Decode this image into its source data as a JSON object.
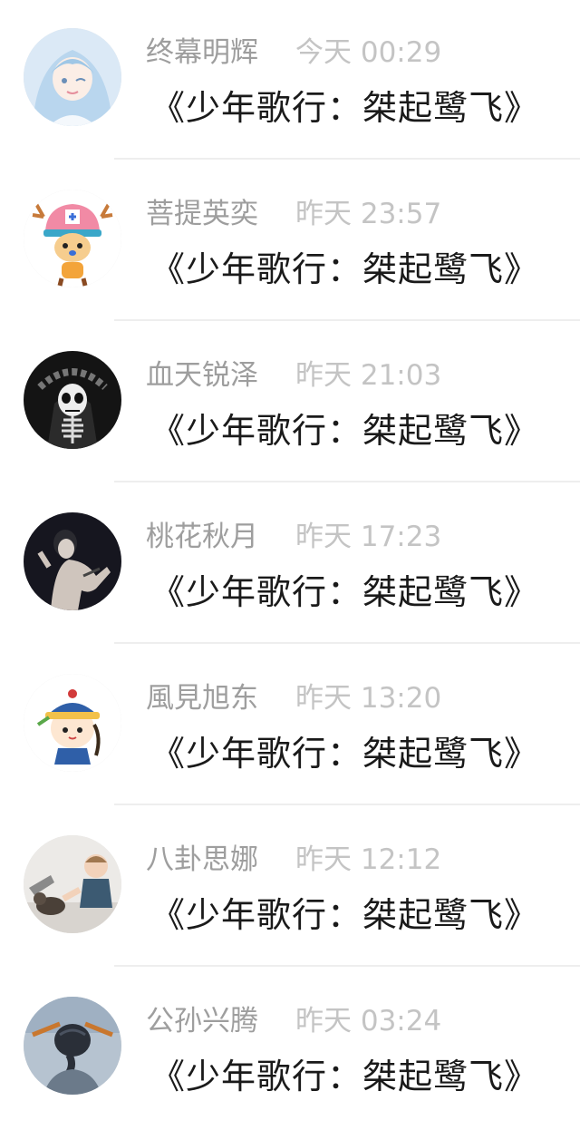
{
  "messages": [
    {
      "name": "终幕明辉",
      "time": "今天 00:29",
      "text": "《少年歌行：桀起鹭飞》",
      "avatar": "anime-girl-avatar-icon",
      "color": "#cfe3f3"
    },
    {
      "name": "菩提英奕",
      "time": "昨天 23:57",
      "text": "《少年歌行：桀起鹭飞》",
      "avatar": "cartoon-reindeer-avatar-icon",
      "color": "#f4c4cf"
    },
    {
      "name": "血天锐泽",
      "time": "昨天 21:03",
      "text": "《少年歌行：桀起鹭飞》",
      "avatar": "skeleton-avatar-icon",
      "color": "#1e1e1e"
    },
    {
      "name": "桃花秋月",
      "time": "昨天 17:23",
      "text": "《少年歌行：桀起鹭飞》",
      "avatar": "person-photo-avatar-icon",
      "color": "#1a1a24"
    },
    {
      "name": "風見旭东",
      "time": "昨天 13:20",
      "text": "《少年歌行：桀起鹭飞》",
      "avatar": "cartoon-qing-official-avatar-icon",
      "color": "#ffffff"
    },
    {
      "name": "八卦思娜",
      "time": "昨天 12:12",
      "text": "《少年歌行：桀起鹭飞》",
      "avatar": "baby-with-cat-avatar-icon",
      "color": "#e9e7e4"
    },
    {
      "name": "公孙兴腾",
      "time": "昨天 03:24",
      "text": "《少年歌行：桀起鹭飞》",
      "avatar": "braided-hair-avatar-icon",
      "color": "#aab8c6"
    }
  ]
}
